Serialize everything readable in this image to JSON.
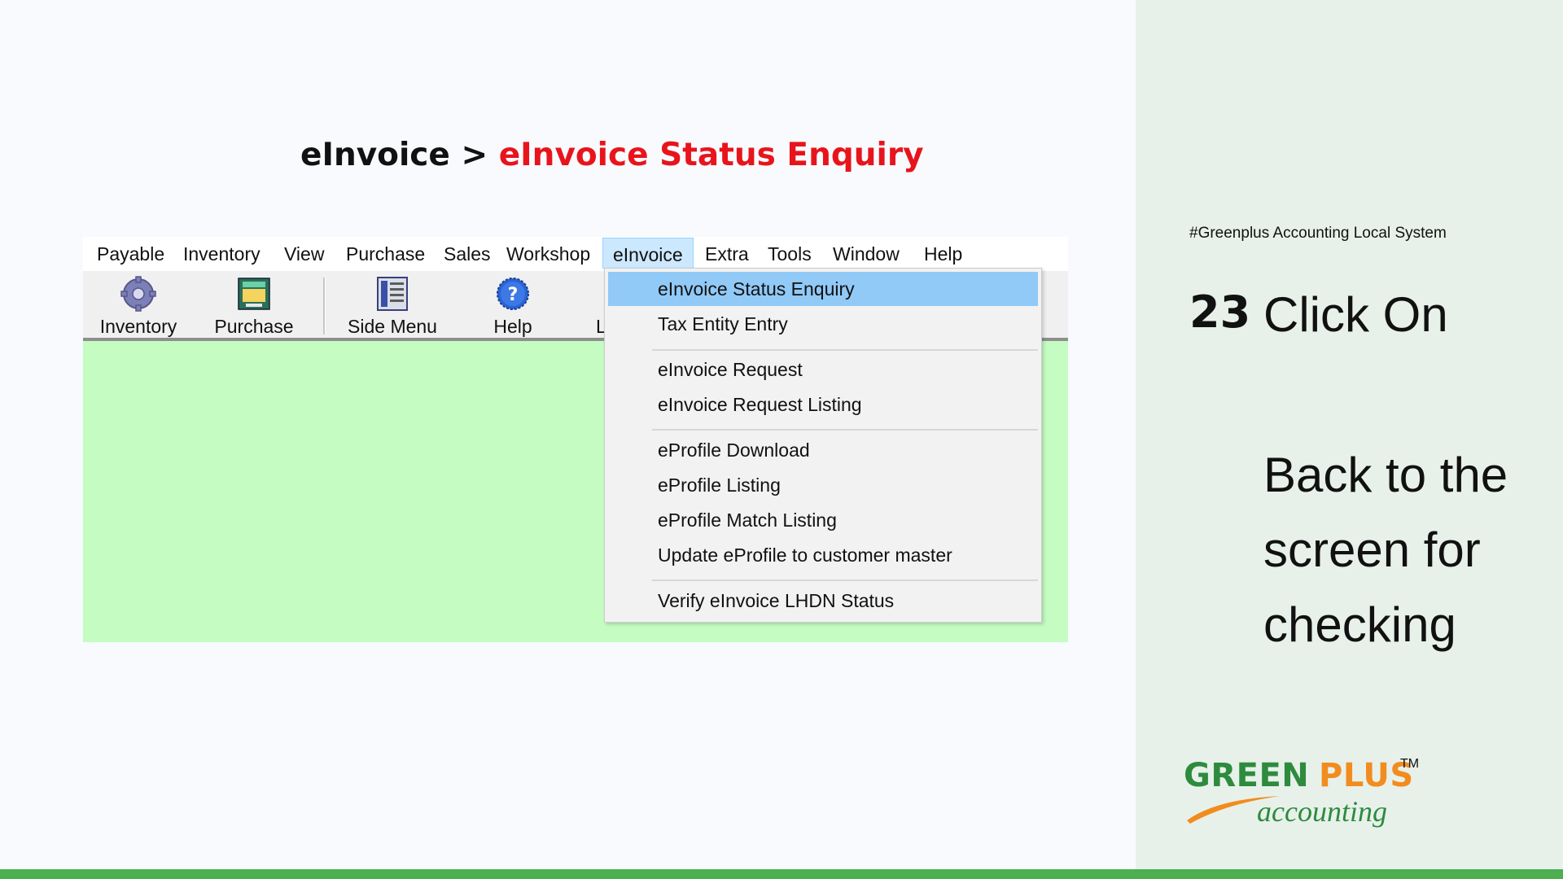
{
  "heading": {
    "part1": "eInvoice > ",
    "part2": "eInvoice Status Enquiry"
  },
  "menubar": {
    "items": [
      "Payable",
      "Inventory",
      "View",
      "Purchase",
      "Sales",
      "Workshop",
      "eInvoice",
      "Extra",
      "Tools",
      "Window",
      "Help"
    ],
    "active": "eInvoice"
  },
  "toolbar": {
    "items": [
      {
        "label": "Inventory",
        "icon": "gear-icon"
      },
      {
        "label": "Purchase",
        "icon": "purchase-icon"
      },
      {
        "label": "Side Menu",
        "icon": "side-menu-icon"
      },
      {
        "label": "Help",
        "icon": "help-icon"
      }
    ],
    "clipped_label": "L"
  },
  "dropdown": {
    "items": [
      "eInvoice Status Enquiry",
      "Tax Entity Entry",
      "eInvoice Request",
      "eInvoice Request Listing",
      "eProfile Download",
      "eProfile Listing",
      "eProfile Match Listing",
      "Update eProfile to customer master",
      "Verify eInvoice LHDN Status"
    ],
    "selected": "eInvoice Status Enquiry"
  },
  "panel": {
    "tag": "#Greenplus Accounting Local System",
    "step_number": "23",
    "step_title": "Click On",
    "step_description": "Back to the screen for checking"
  },
  "logo": {
    "word1": "GREEN",
    "word2": "PLUS",
    "trademark": "TM",
    "subtitle": "accounting"
  },
  "colors": {
    "accent_red": "#e8141c",
    "app_background": "#c4fcc2",
    "selected_item": "#91c9f7",
    "panel_background": "#e7f1ea",
    "bottom_bar": "#4caf50",
    "logo_green": "#2e8b3e",
    "logo_orange": "#f28c1e"
  }
}
